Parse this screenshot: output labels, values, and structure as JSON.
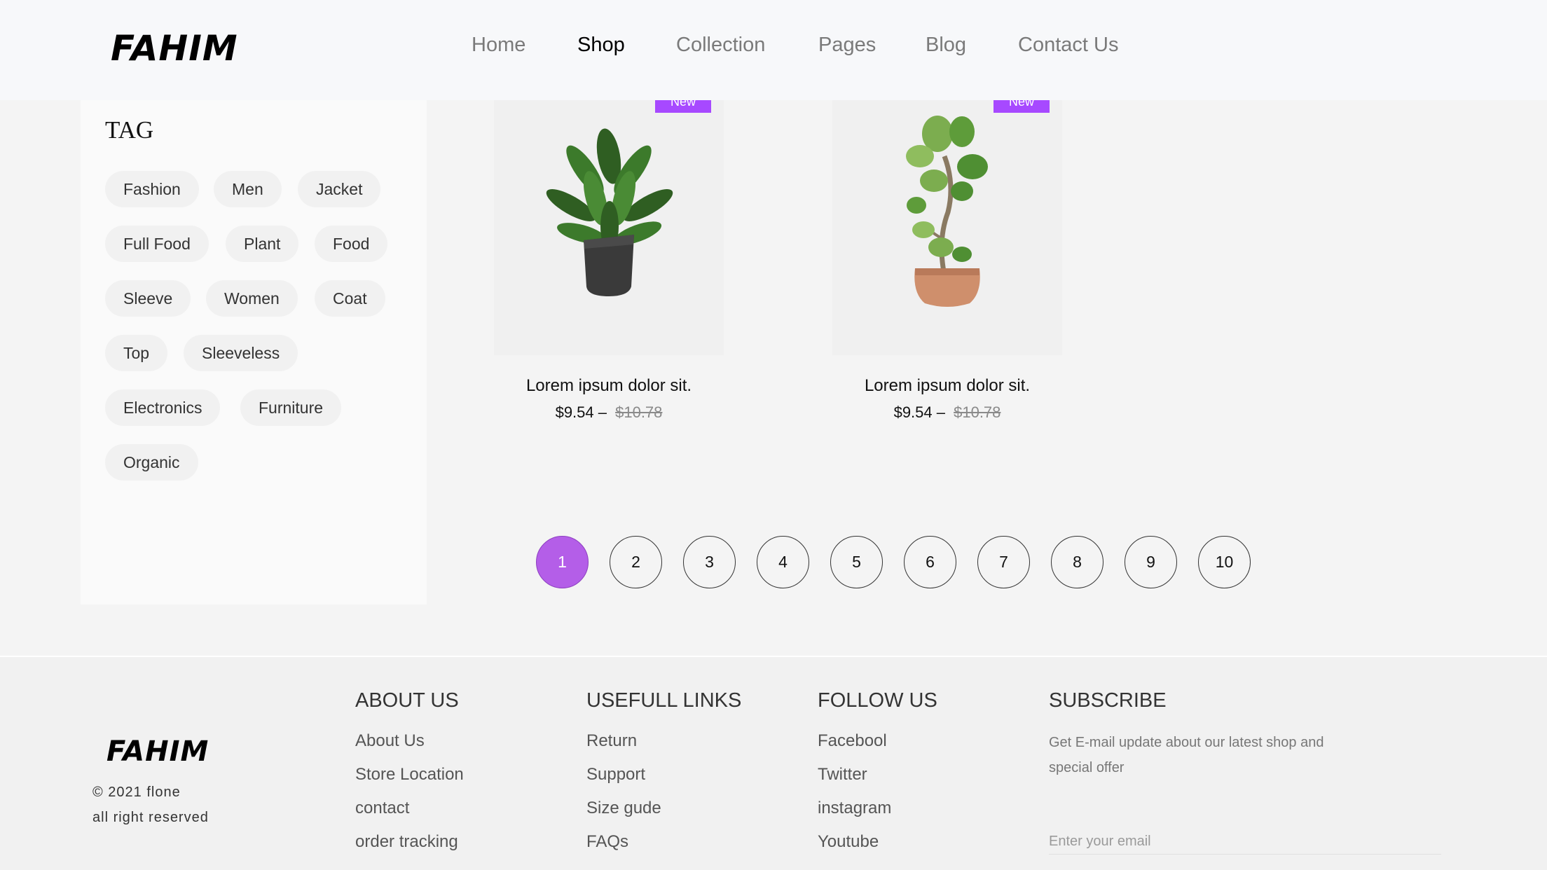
{
  "header": {
    "logo": "FAHIM",
    "nav": [
      {
        "label": "Home"
      },
      {
        "label": "Shop",
        "active": true
      },
      {
        "label": "Collection"
      },
      {
        "label": "Pages"
      },
      {
        "label": "Blog"
      },
      {
        "label": "Contact Us"
      }
    ]
  },
  "sidebar": {
    "title": "TAG",
    "tags": [
      "Fashion",
      "Men",
      "Jacket",
      "Full Food",
      "Plant",
      "Food",
      "Sleeve",
      "Women",
      "Coat",
      "Top",
      "Sleeveless",
      "Electronics",
      "Furniture",
      "Organic"
    ]
  },
  "products": [
    {
      "badge": "New",
      "name": "Lorem ipsum dolor sit.",
      "price": "$9.54",
      "old_price": "$10.78",
      "image_icon": "plant-dark-pot-icon"
    },
    {
      "badge": "New",
      "name": "Lorem ipsum dolor sit.",
      "price": "$9.54",
      "old_price": "$10.78",
      "image_icon": "plant-terracotta-pot-icon"
    }
  ],
  "pagination": {
    "pages": [
      "1",
      "2",
      "3",
      "4",
      "5",
      "6",
      "7",
      "8",
      "9",
      "10"
    ],
    "current": "1",
    "active_color": "#b45ee8"
  },
  "footer": {
    "logo": "FAHIM",
    "copyright_line1": "© 2021 flone",
    "copyright_line2": "all right reserved",
    "about": {
      "title": "ABOUT US",
      "links": [
        "About Us",
        "Store Location",
        "contact",
        "order tracking"
      ]
    },
    "links": {
      "title": "USEFULL LINKS",
      "links": [
        "Return",
        "Support",
        "Size gude",
        "FAQs"
      ]
    },
    "follow": {
      "title": "FOLLOW US",
      "links": [
        "Facebool",
        "Twitter",
        "instagram",
        "Youtube"
      ]
    },
    "subscribe": {
      "title": "SUBSCRIBE",
      "text": "Get E-mail update about our latest shop and special offer",
      "placeholder": "Enter your email"
    }
  },
  "colors": {
    "accent": "#a749ff"
  }
}
